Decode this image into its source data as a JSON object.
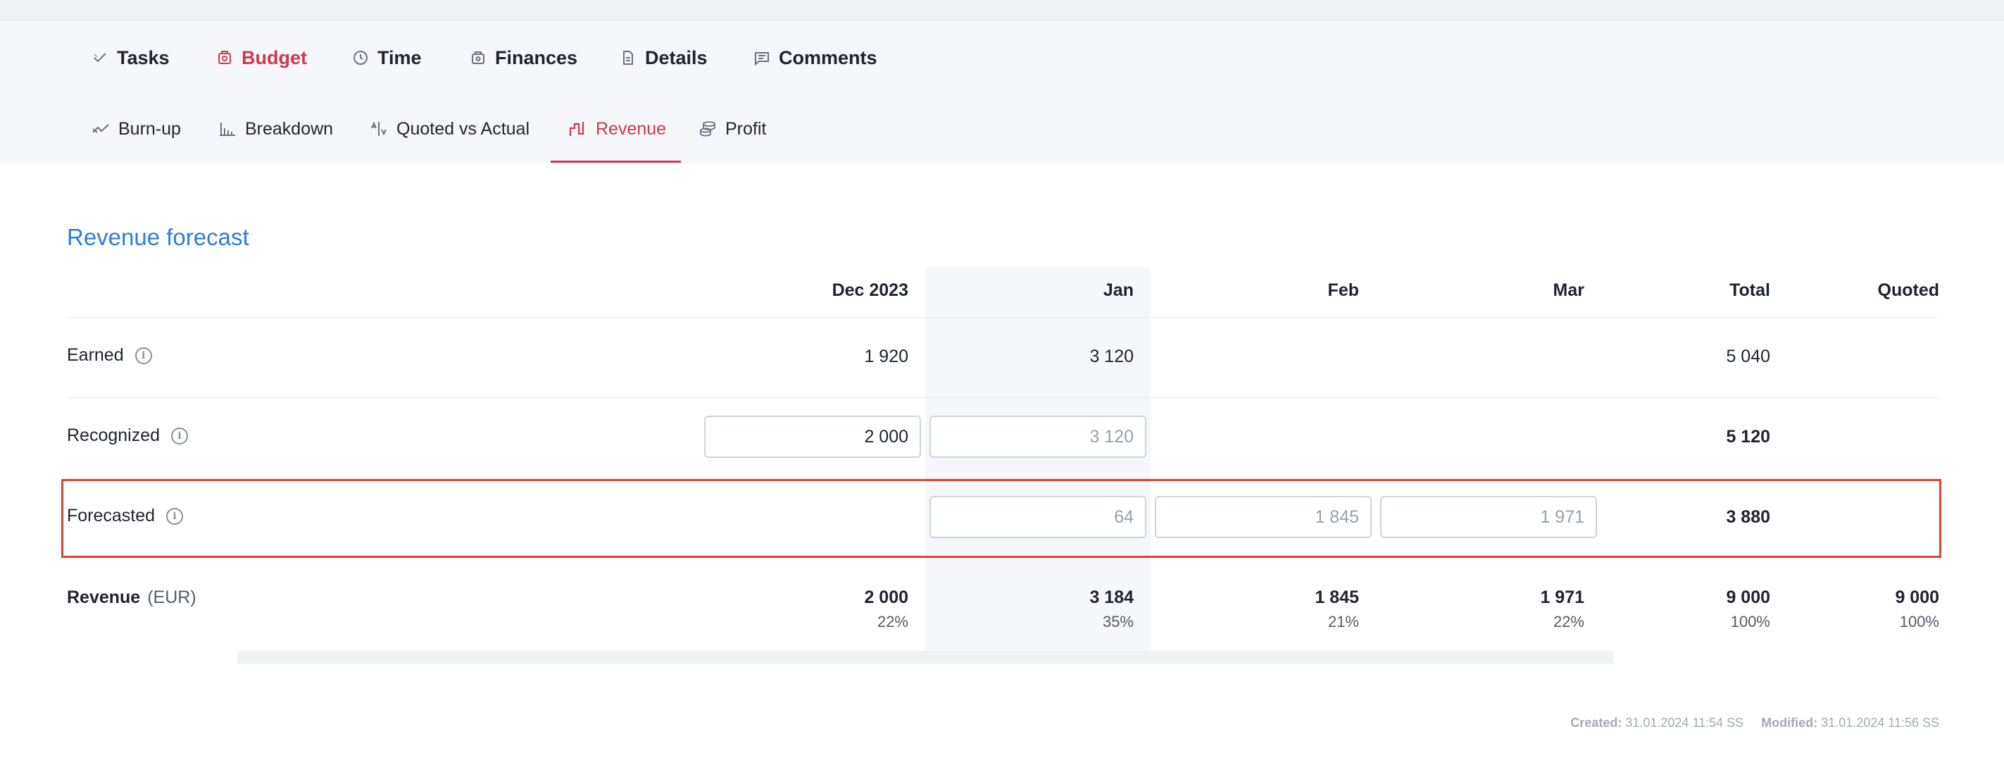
{
  "tabs": [
    {
      "label": "Tasks",
      "icon": "check-icon"
    },
    {
      "label": "Budget",
      "icon": "budget-icon",
      "active": true
    },
    {
      "label": "Time",
      "icon": "clock-icon"
    },
    {
      "label": "Finances",
      "icon": "finances-icon"
    },
    {
      "label": "Details",
      "icon": "document-icon"
    },
    {
      "label": "Comments",
      "icon": "comment-icon"
    }
  ],
  "subtabs": [
    {
      "label": "Burn-up",
      "icon": "burnup-icon"
    },
    {
      "label": "Breakdown",
      "icon": "breakdown-icon"
    },
    {
      "label": "Quoted vs Actual",
      "icon": "quoted-vs-actual-icon"
    },
    {
      "label": "Revenue",
      "icon": "revenue-icon",
      "active": true
    },
    {
      "label": "Profit",
      "icon": "coins-icon"
    }
  ],
  "section_title": "Revenue forecast",
  "columns": [
    "Dec 2023",
    "Jan",
    "Feb",
    "Mar",
    "Total",
    "Quoted"
  ],
  "rows": {
    "earned": {
      "label": "Earned",
      "dec": "1 920",
      "jan": "3 120",
      "total": "5 040"
    },
    "recognized": {
      "label": "Recognized",
      "dec_value": "2 000",
      "jan_placeholder": "3 120",
      "total": "5 120"
    },
    "forecasted": {
      "label": "Forecasted",
      "jan_placeholder": "64",
      "feb_placeholder": "1 845",
      "mar_placeholder": "1 971",
      "total": "3 880"
    },
    "revenue": {
      "label": "Revenue",
      "unit": "(EUR)",
      "dec": "2 000",
      "dec_pct": "22%",
      "jan": "3 184",
      "jan_pct": "35%",
      "feb": "1 845",
      "feb_pct": "21%",
      "mar": "1 971",
      "mar_pct": "22%",
      "total": "9 000",
      "total_pct": "100%",
      "quoted": "9 000",
      "quoted_pct": "100%"
    }
  },
  "footer": {
    "created_label": "Created:",
    "created_value": "31.01.2024 11:54 SS",
    "modified_label": "Modified:",
    "modified_value": "31.01.2024 11:56 SS"
  },
  "colors": {
    "accent": "#d0384d",
    "title": "#2e7fd6",
    "highlight": "#e0442f"
  }
}
